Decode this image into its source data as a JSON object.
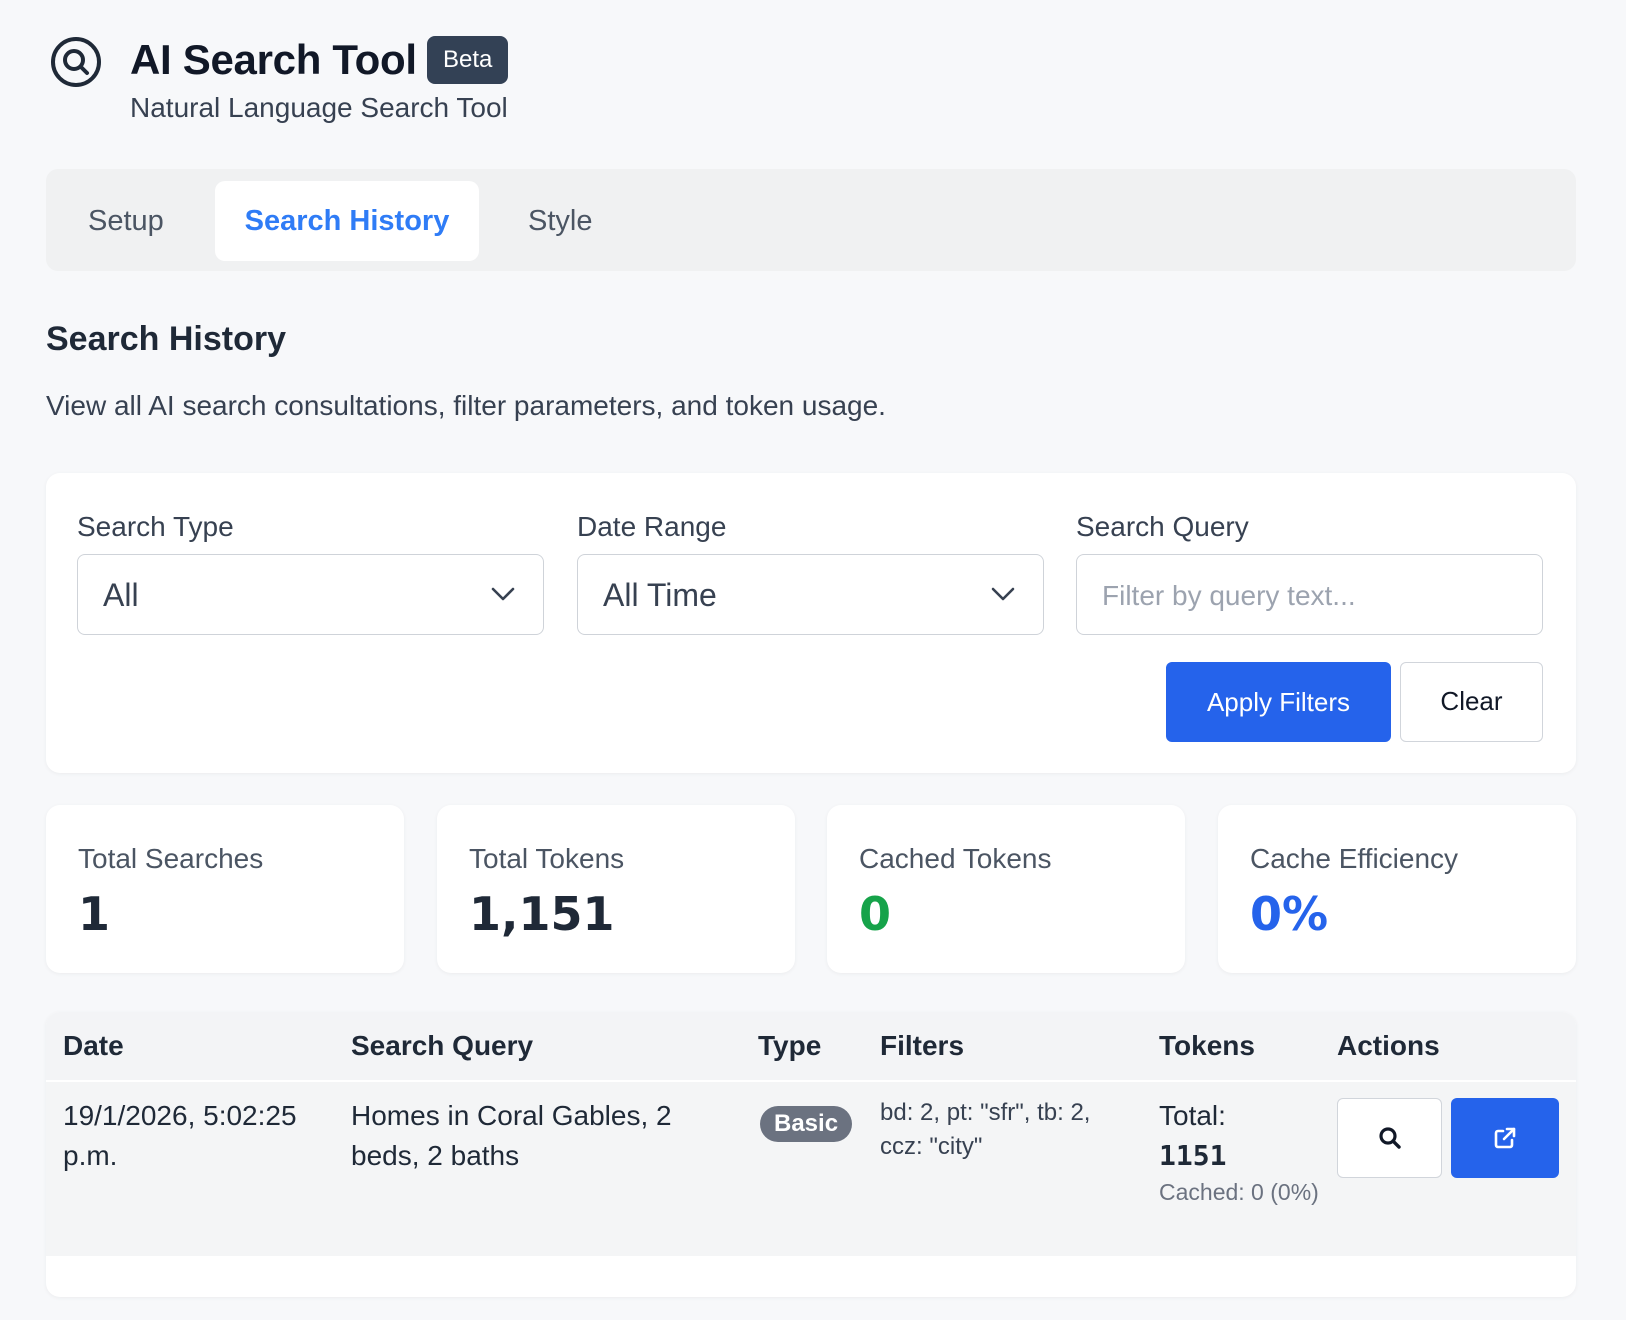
{
  "header": {
    "title": "AI Search Tool",
    "badge": "Beta",
    "subtitle": "Natural Language Search Tool",
    "icon": "search-circle-icon"
  },
  "tabs": [
    {
      "label": "Setup",
      "active": false
    },
    {
      "label": "Search History",
      "active": true
    },
    {
      "label": "Style",
      "active": false
    }
  ],
  "section": {
    "title": "Search History",
    "description": "View all AI search consultations, filter parameters, and token usage."
  },
  "filters": {
    "search_type": {
      "label": "Search Type",
      "value": "All"
    },
    "date_range": {
      "label": "Date Range",
      "value": "All Time"
    },
    "search_query": {
      "label": "Search Query",
      "placeholder": "Filter by query text...",
      "value": ""
    },
    "apply_label": "Apply Filters",
    "clear_label": "Clear"
  },
  "stats": [
    {
      "label": "Total Searches",
      "value": "1",
      "color": "#1f2937"
    },
    {
      "label": "Total Tokens",
      "value": "1,151",
      "color": "#1f2937"
    },
    {
      "label": "Cached Tokens",
      "value": "0",
      "color": "#16a34a"
    },
    {
      "label": "Cache Efficiency",
      "value": "0%",
      "color": "#2563eb"
    }
  ],
  "table": {
    "headers": [
      "Date",
      "Search Query",
      "Type",
      "Filters",
      "Tokens",
      "Actions"
    ],
    "rows": [
      {
        "date": "19/1/2026, 5:02:25 p.m.",
        "query": "Homes in Coral Gables, 2 beds, 2 baths",
        "type": "Basic",
        "filters": "bd: 2, pt: \"sfr\", tb: 2, ccz: \"city\"",
        "tokens_total_label": "Total:",
        "tokens_total": "1151",
        "tokens_cached": "Cached: 0 (0%)",
        "actions": [
          "search-icon",
          "external-link-icon"
        ]
      }
    ]
  },
  "colors": {
    "accent": "#2563eb",
    "active_tab": "#2f7cf6",
    "badge_bg": "#334155",
    "type_badge_bg": "#6b7280"
  }
}
